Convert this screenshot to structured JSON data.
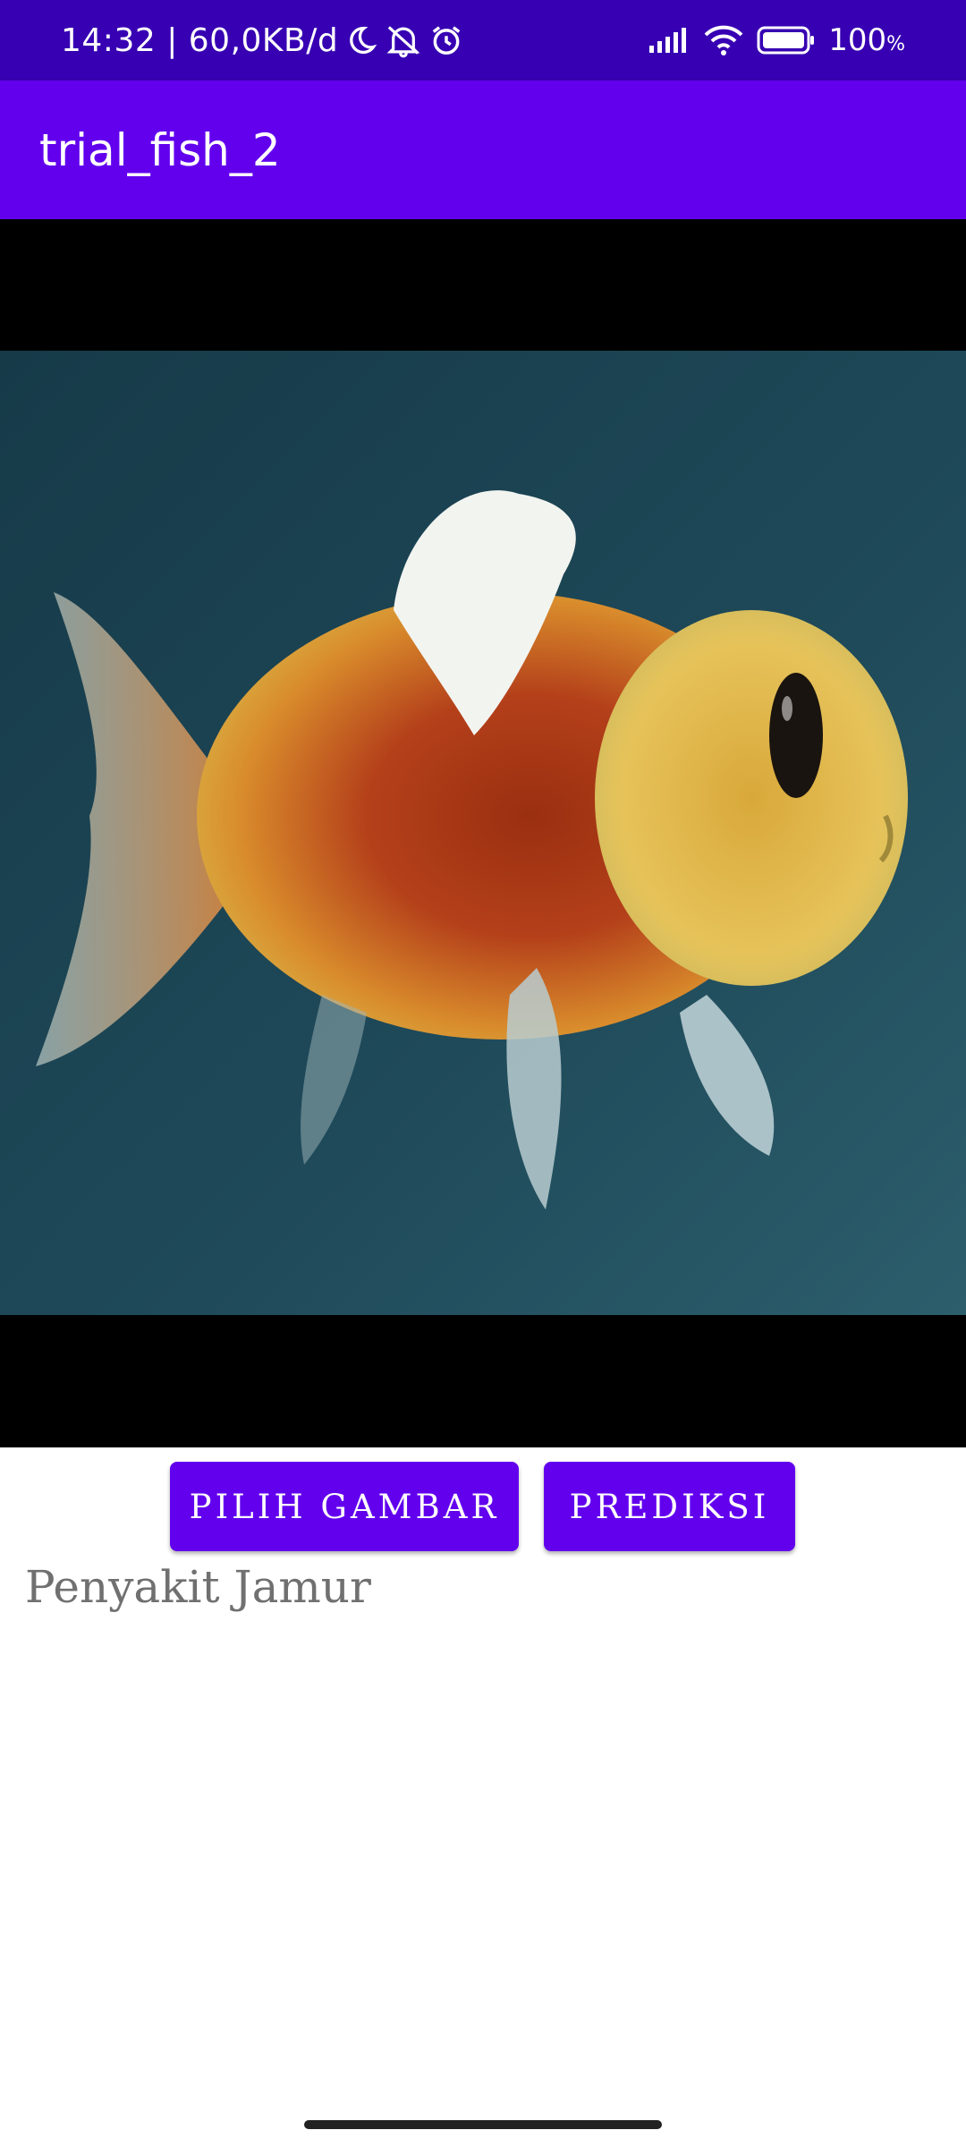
{
  "status_bar": {
    "time_and_speed": "14:32 | 60,0KB/d",
    "battery_text": "100",
    "icons": [
      "moon-icon",
      "bell-muted-icon",
      "alarm-icon",
      "signal-icon",
      "wifi-icon",
      "battery-icon"
    ]
  },
  "app_bar": {
    "title": "trial_fish_2"
  },
  "image_view": {
    "content": "fish-photo"
  },
  "buttons": {
    "pick_image": "PILIH GAMBAR",
    "predict": "PREDIKSI"
  },
  "result": {
    "label": "Penyakit Jamur"
  },
  "colors": {
    "status_bar": "#3700B3",
    "app_bar": "#6200EE",
    "button": "#6200EE",
    "result_text": "#707070"
  }
}
